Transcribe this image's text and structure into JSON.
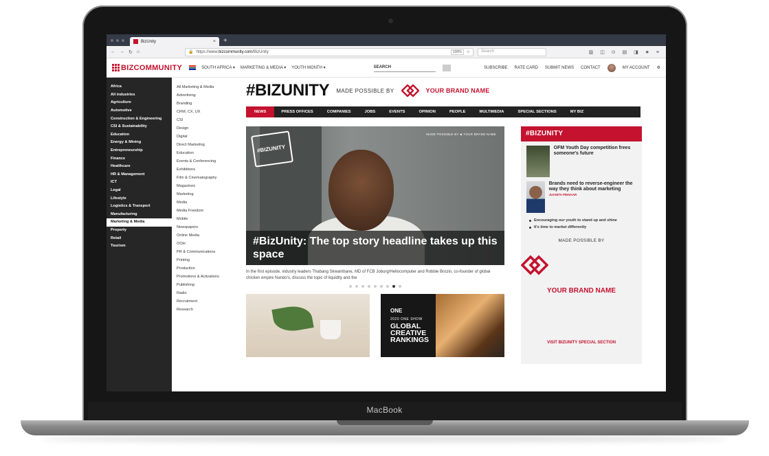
{
  "device": {
    "label": "MacBook"
  },
  "browser": {
    "tab_title": "BizUnity",
    "url_prefix": "https://www.",
    "url_host": "bizcommunity.com",
    "url_path": "/BizUnity",
    "zoom": "100%",
    "search_placeholder": "Search"
  },
  "site": {
    "logo_text": "BIZCOMMUNITY",
    "region": "SOUTH AFRICA",
    "nav": [
      "MARKETING & MEDIA",
      "YOUTH MONTH"
    ],
    "search_label": "SEARCH",
    "links": [
      "SUBSCRIBE",
      "RATE CARD",
      "SUBMIT NEWS",
      "CONTACT",
      "MY ACCOUNT"
    ]
  },
  "left_menu": [
    "Africa",
    "All industries",
    "Agriculture",
    "Automotive",
    "Construction & Engineering",
    "CSI & Sustainability",
    "Education",
    "Energy & Mining",
    "Entrepreneurship",
    "Finance",
    "Healthcare",
    "HR & Management",
    "ICT",
    "Legal",
    "Lifestyle",
    "Logistics & Transport",
    "Manufacturing",
    "Marketing & Media",
    "Property",
    "Retail",
    "Tourism"
  ],
  "left_menu_active": "Marketing & Media",
  "sub_menu": [
    "All Marketing & Media",
    "Advertising",
    "Branding",
    "CRM, CX, UX",
    "CSI",
    "Design",
    "Digital",
    "Direct Marketing",
    "Education",
    "Events & Conferencing",
    "Exhibitions",
    "Film & Cinematography",
    "Magazines",
    "Marketing",
    "Media",
    "Media Freedom",
    "Mobile",
    "Newspapers",
    "Online Media",
    "OOH",
    "PR & Communications",
    "Printing",
    "Production",
    "Promotions & Activations",
    "Publishing",
    "Radio",
    "Recruitment",
    "Research"
  ],
  "page": {
    "title": "#BIZUNITY",
    "made_possible_by": "MADE POSSIBLE BY",
    "brand_name": "YOUR BRAND NAME"
  },
  "section_menu": [
    "NEWS",
    "PRESS OFFICES",
    "COMPANIES",
    "JOBS",
    "EVENTS",
    "OPINION",
    "PEOPLE",
    "MULTIMEDIA",
    "SPECIAL SECTIONS",
    "MY BIZ"
  ],
  "hero": {
    "badge": "#BIZUNITY",
    "made_possible": "MADE POSSIBLE BY",
    "brand": "YOUR BRAND NAME",
    "headline": "#BizUnity: The top story headline takes up this space",
    "summary": "In the first episode, industry leaders Thabang Skwambane, MD of FCB Joburg/Hellocomputer and Robbie Brozin, co-founder of global chicken empire Nando's, discuss the topic of liquidity and the"
  },
  "pager": {
    "count": 9,
    "current": 8
  },
  "thumb2": {
    "one": "ONE",
    "sub": "2020 ONE SHOW",
    "line1": "GLOBAL",
    "line2": "CREATIVE",
    "line3": "RANKINGS"
  },
  "sidebar": {
    "title": "#BIZUNITY",
    "items": [
      {
        "title": "OFM Youth Day competition frees someone's future",
        "author": ""
      },
      {
        "title": "Brands need to reverse-engineer the way they think about marketing",
        "author": "JUANITA PIENAAR"
      }
    ],
    "bullets": [
      "Encouraging our youth to stand up and shine",
      "It's time to market differently"
    ],
    "made_possible": "MADE POSSIBLE BY",
    "brand_name": "YOUR BRAND NAME",
    "visit": "VISIT BIZUNITY SPECIAL SECTION"
  },
  "colors": {
    "brand_red": "#c4122f",
    "dark": "#222222",
    "sidebar_bg": "#262626"
  }
}
